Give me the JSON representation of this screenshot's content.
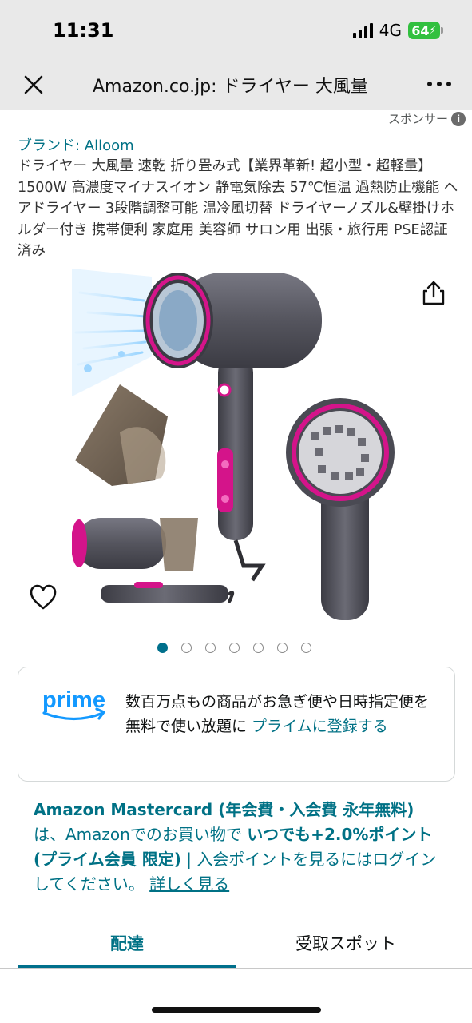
{
  "status_bar": {
    "time": "11:31",
    "network": "4G",
    "battery": "64"
  },
  "nav": {
    "title": "Amazon.co.jp: ドライヤー 大風量"
  },
  "sponsor_label": "スポンサー",
  "product": {
    "brand": "ブランド: Alloom",
    "title": "ドライヤー 大風量 速乾 折り畳み式【業界革新! 超小型・超軽量】1500W 高濃度マイナスイオン 静電気除去 57℃恒温 過熱防止機能 ヘアドライヤー 3段階調整可能 温冷風切替 ドライヤーノズル&壁掛けホルダー付き 携帯便利 家庭用 美容師 サロン用 出張・旅行用 PSE認証済み"
  },
  "gallery": {
    "image_count": 7,
    "active_index": 0
  },
  "prime": {
    "logo_text": "prime",
    "message": "数百万点もの商品がお急ぎ便や日時指定便を無料で使い放題に ",
    "link": "プライムに登録する"
  },
  "mastercard": {
    "bold1": "Amazon Mastercard (年会費・入会費 永年無料)",
    "text1": "は、Amazonでのお買い物で ",
    "bold2": "いつでも+2.0%ポイント (プライム会員 限定)",
    "text2": " | 入会ポイントを見るにはログインしてください。 ",
    "more": "詳しく見る"
  },
  "tabs": {
    "delivery": "配達",
    "pickup": "受取スポット"
  },
  "colors": {
    "link": "#007185",
    "accent": "#00708c",
    "prime_blue": "#1399ff",
    "product_magenta": "#d4148a"
  }
}
